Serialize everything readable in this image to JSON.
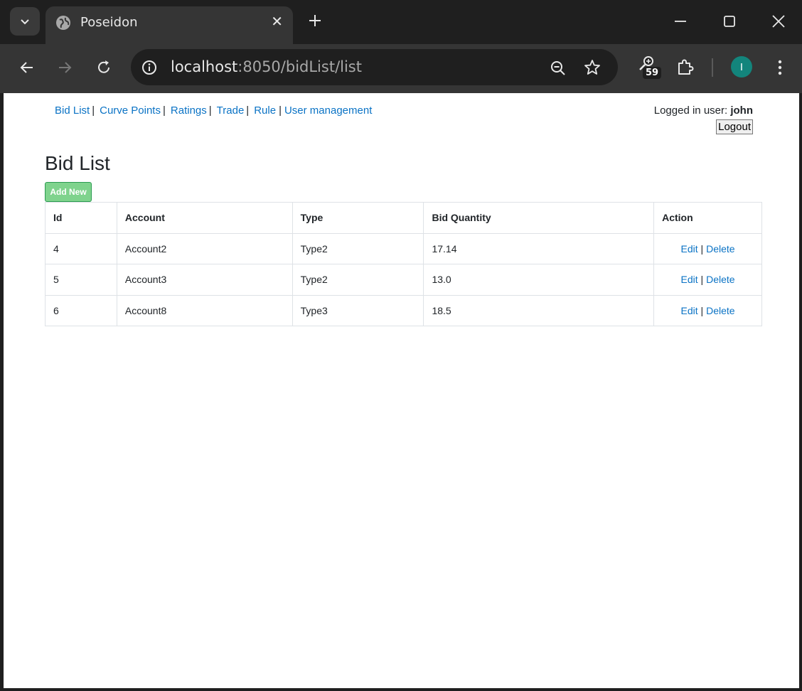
{
  "browser": {
    "tab_title": "Poseidon",
    "url_host": "localhost",
    "url_rest": ":8050/bidList/list",
    "extension_count": "59",
    "profile_initial": "I"
  },
  "nav": {
    "bid_list": "Bid List",
    "curve_points": "Curve Points",
    "ratings": "Ratings",
    "trade": "Trade",
    "rule": "Rule",
    "user_management": "User management",
    "separator": "|"
  },
  "user": {
    "label": "Logged in user:",
    "name": "john",
    "logout": "Logout"
  },
  "page": {
    "title": "Bid List",
    "add_new": "Add New"
  },
  "table": {
    "headers": [
      "Id",
      "Account",
      "Type",
      "Bid Quantity",
      "Action"
    ],
    "rows": [
      {
        "id": "4",
        "account": "Account2",
        "type": "Type2",
        "bid_quantity": "17.14"
      },
      {
        "id": "5",
        "account": "Account3",
        "type": "Type2",
        "bid_quantity": "13.0"
      },
      {
        "id": "6",
        "account": "Account8",
        "type": "Type3",
        "bid_quantity": "18.5"
      }
    ],
    "edit_label": "Edit",
    "delete_label": "Delete",
    "action_sep": "|"
  }
}
